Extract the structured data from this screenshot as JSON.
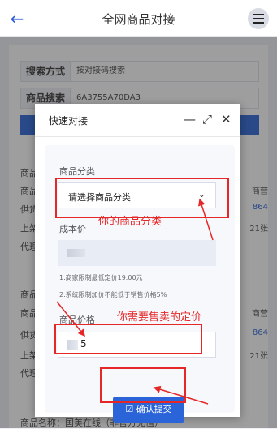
{
  "topbar": {
    "title": "全网商品对接",
    "back_icon": "←"
  },
  "search": {
    "method_label": "搜索方式",
    "method_value": "按对接码搜索",
    "goods_label": "商品搜索",
    "goods_value": "6A3755A70DA3"
  },
  "background": {
    "row1": [
      "商品",
      "商品",
      "供货",
      "上架",
      "代理"
    ],
    "row2": [
      "商品",
      "商品",
      "供货",
      "上架",
      "代理"
    ],
    "right1": [
      "商营",
      "864",
      "21张"
    ],
    "right2": [
      "商营",
      "864",
      "21张"
    ],
    "bottom_text": "商品名称：国美在线（非官方充值）"
  },
  "modal": {
    "title": "快速对接",
    "minimize": "—",
    "maximize": "⤢",
    "close": "✕",
    "category_label": "商品分类",
    "category_placeholder": "请选择商品分类",
    "cost_label": "成本价",
    "note1": "1.商家限制最低定价19.00元",
    "note2": "2.系统限制加价不能低于销售价格5%",
    "price_label": "商品价格",
    "price_value": "5",
    "confirm_label": "确认提交",
    "confirm_icon": "☑"
  },
  "annotations": {
    "category_note": "你的商品分类",
    "price_note": "你需要售卖的定价",
    "color": "#e52727"
  }
}
